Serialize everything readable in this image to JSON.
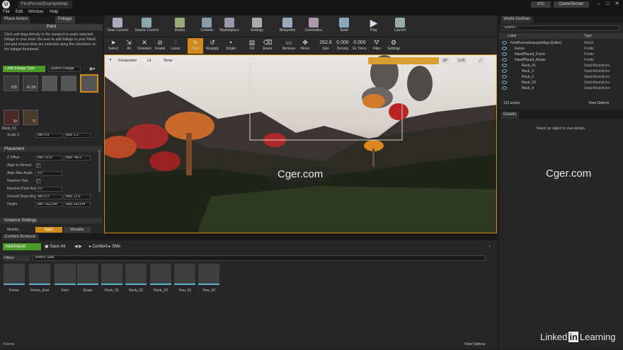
{
  "window": {
    "tab_title": "FirstPersonExampleMap",
    "engine_badge": "DDC",
    "project": "GameTerrain"
  },
  "menu": [
    "File",
    "Edit",
    "Window",
    "Help"
  ],
  "left_panel": {
    "tabs": [
      "Place Actors",
      "Foliage"
    ],
    "mode_title": "Paint",
    "help": "Click and drag directly in the viewport to paint selected foliage in your level. Be sure to add foliage to your Mesh List and ensure they are selected using the checkbox on the foliage thumbnail.",
    "add_button": "+ Add Foliage Type",
    "search_placeholder": "Search Foliage",
    "thumbs": [
      {
        "count": "635"
      },
      {
        "count": "41.5K"
      },
      {
        "count": ""
      },
      {
        "count": ""
      },
      {
        "count": ""
      },
      {
        "count": "39"
      },
      {
        "count": "71"
      }
    ],
    "selected_type": "Rock_03",
    "scale_row": {
      "label": "Scale X",
      "min": "Min 0.8",
      "max": "Max 1.3"
    },
    "placement_header": "Placement",
    "placement_rows": [
      {
        "label": "Z Offset",
        "min": "Min -60.0",
        "max": "Max -40.0"
      },
      {
        "label": "Align to Normal",
        "check": true
      },
      {
        "label": "Align Max Angle",
        "value": "0.0"
      },
      {
        "label": "Random Yaw",
        "check": true
      },
      {
        "label": "Random Pitch Ang",
        "value": "0.0"
      },
      {
        "label": "Ground Slope Ang",
        "min": "Min 0.0",
        "max": "Max 12.5"
      },
      {
        "label": "Height",
        "min": "Min -262144",
        "max": "Max 262144"
      }
    ],
    "instance_header": "Instance Settings",
    "mobility": {
      "label": "Mobility",
      "static": "Static",
      "movable": "Movable"
    }
  },
  "toolbar": [
    "Save Current",
    "Source Control",
    "Modes",
    "Content",
    "Marketplace",
    "Settings",
    "Blueprints",
    "Cinematics",
    "Build",
    "Play",
    "Launch"
  ],
  "mode_toolbar": {
    "tools": [
      "Select",
      "All",
      "Deselect",
      "Invalid",
      "Lasso",
      "Paint",
      "Reapply",
      "Single",
      "Fill",
      "Erase",
      "Remove",
      "Move"
    ],
    "size": {
      "value": "262.8",
      "label": "Size"
    },
    "density": {
      "value": "0.000",
      "label": "Density"
    },
    "erase_density": {
      "value": "0.000",
      "label": "Er. Dens"
    },
    "filter": "Filter",
    "settings": "Settings"
  },
  "viewport": {
    "perspective": "Perspective",
    "lit": "Lit",
    "show": "Show",
    "angle": "10°",
    "speed": "0.25",
    "watermark": "Cger.com"
  },
  "content_browser": {
    "tab": "Content Browser",
    "add_import": "Add/Import",
    "save_all": "Save All",
    "path": [
      "Content",
      "SMs"
    ],
    "filters": "Filters",
    "search_placeholder": "Search SMs",
    "assets": [
      "Fence",
      "Fence_End",
      "Fern",
      "Grass",
      "Rock_01",
      "Rock_02",
      "Rock_03",
      "Tree_01",
      "Tree_02"
    ],
    "item_count": "9 items",
    "view_options": "View Options"
  },
  "outliner": {
    "tab": "World Outliner",
    "search_placeholder": "Search...",
    "col_label": "Label",
    "col_type": "Type",
    "rows": [
      {
        "name": "FirstPersonExampleMap (Editor)",
        "type": "World",
        "indent": 0
      },
      {
        "name": "Fence",
        "type": "Folder",
        "indent": 1
      },
      {
        "name": "HandPlaced_Ferns",
        "type": "Folder",
        "indent": 1
      },
      {
        "name": "HandPlaced_Rocks",
        "type": "Folder",
        "indent": 1
      },
      {
        "name": "Rock_01",
        "type": "StaticMeshActor",
        "indent": 2
      },
      {
        "name": "Rock_2",
        "type": "StaticMeshActor",
        "indent": 2
      },
      {
        "name": "Rock_2",
        "type": "StaticMeshActor",
        "indent": 2
      },
      {
        "name": "Rock_03",
        "type": "StaticMeshActor",
        "indent": 2
      },
      {
        "name": "Rock_4",
        "type": "StaticMeshActor",
        "indent": 2
      }
    ],
    "actor_count": "122 actors",
    "view_options": "View Options"
  },
  "details": {
    "tab": "Details",
    "empty": "Select an object to view details."
  },
  "watermark": {
    "site": "Cger.com",
    "brand": "Linked",
    "brand_in": "in",
    "brand_tail": "Learning"
  },
  "colors": {
    "accent": "#d08a1a",
    "add_green": "#4a9a2a",
    "asset_stripe": "#5ab3cc"
  }
}
